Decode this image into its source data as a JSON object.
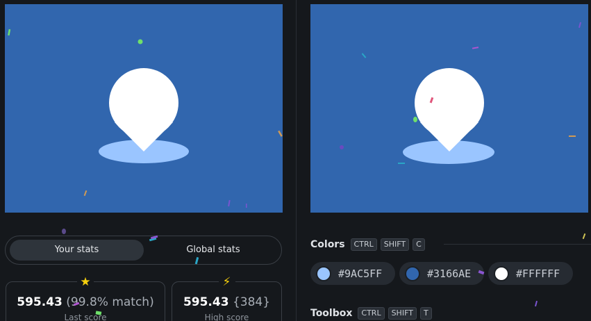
{
  "colors": {
    "background": "#15181c",
    "target_bg": "#3166AE",
    "pin_white": "#FFFFFF",
    "shadow_light": "#9AC5FF"
  },
  "stats_toggle": {
    "your_stats": "Your stats",
    "global_stats": "Global stats",
    "selected": "Your stats"
  },
  "last_score": {
    "icon": "star-icon",
    "score": "595.43",
    "match": "(99.8% match)",
    "label": "Last score"
  },
  "high_score": {
    "icon": "lightning-icon",
    "score": "595.43",
    "rank": "{384}",
    "label": "High score"
  },
  "colors_section": {
    "title": "Colors",
    "shortcut": [
      "CTRL",
      "SHIFT",
      "C"
    ],
    "swatches": [
      {
        "hex": "#9AC5FF",
        "color": "#9AC5FF"
      },
      {
        "hex": "#3166AE",
        "color": "#3166AE"
      },
      {
        "hex": "#FFFFFF",
        "color": "#FFFFFF"
      }
    ]
  },
  "toolbox_section": {
    "title": "Toolbox",
    "shortcut": [
      "CTRL",
      "SHIFT",
      "T"
    ]
  }
}
